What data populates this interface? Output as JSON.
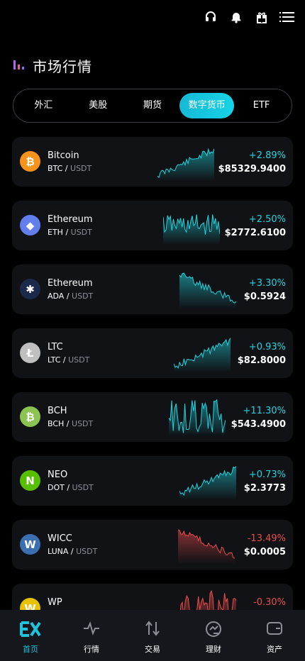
{
  "header": {
    "icons": [
      "headset-icon",
      "bell-icon",
      "gift-icon",
      "menu-icon"
    ],
    "title": "市场行情"
  },
  "tabs": [
    {
      "label": "外汇",
      "active": false
    },
    {
      "label": "美股",
      "active": false
    },
    {
      "label": "期货",
      "active": false
    },
    {
      "label": "数字货币",
      "active": true
    },
    {
      "label": "ETF",
      "active": false
    }
  ],
  "markets": [
    {
      "name": "Bitcoin",
      "base": "BTC",
      "quote": "USDT",
      "change": "+2.89%",
      "price": "$85329.9400",
      "trend": "up",
      "icon": "bitcoin-icon",
      "icon_color": "#f7931a",
      "glyph": "₿"
    },
    {
      "name": "Ethereum",
      "base": "ETH",
      "quote": "USDT",
      "change": "+2.50%",
      "price": "$2772.6100",
      "trend": "up",
      "icon": "ethereum-icon",
      "icon_color": "#627eea",
      "glyph": "◆"
    },
    {
      "name": "Ethereum",
      "base": "ADA",
      "quote": "USDT",
      "change": "+3.30%",
      "price": "$0.5924",
      "trend": "up",
      "icon": "cardano-icon",
      "icon_color": "#1b2a4a",
      "glyph": "✱"
    },
    {
      "name": "LTC",
      "base": "LTC",
      "quote": "USDT",
      "change": "+0.93%",
      "price": "$82.8000",
      "trend": "up",
      "icon": "litecoin-icon",
      "icon_color": "#bfbfbf",
      "glyph": "Ł"
    },
    {
      "name": "BCH",
      "base": "BCH",
      "quote": "USDT",
      "change": "+11.30%",
      "price": "$543.4900",
      "trend": "up",
      "icon": "bitcoin-cash-icon",
      "icon_color": "#8dc351",
      "glyph": "₿"
    },
    {
      "name": "NEO",
      "base": "DOT",
      "quote": "USDT",
      "change": "+0.73%",
      "price": "$2.3773",
      "trend": "up",
      "icon": "neo-icon",
      "icon_color": "#58bf00",
      "glyph": "N"
    },
    {
      "name": "WICC",
      "base": "LUNA",
      "quote": "USDT",
      "change": "-13.49%",
      "price": "$0.0005",
      "trend": "down",
      "icon": "wicc-icon",
      "icon_color": "#3b6fb0",
      "glyph": "W"
    },
    {
      "name": "WP",
      "base": "",
      "quote": "",
      "change": "-0.30%",
      "price": "",
      "trend": "down",
      "icon": "wp-icon",
      "icon_color": "#e6c200",
      "glyph": "W"
    }
  ],
  "bottom_nav": [
    {
      "label": "首页",
      "icon": "home-logo-icon",
      "active": true
    },
    {
      "label": "行情",
      "icon": "pulse-icon",
      "active": false
    },
    {
      "label": "交易",
      "icon": "swap-arrows-icon",
      "active": false
    },
    {
      "label": "理财",
      "icon": "finance-icon",
      "active": false
    },
    {
      "label": "资产",
      "icon": "wallet-icon",
      "active": false
    }
  ],
  "colors": {
    "accent": "#1fc3dc",
    "up": "#22d3dc",
    "down": "#e84b4b",
    "card": "#101216"
  }
}
